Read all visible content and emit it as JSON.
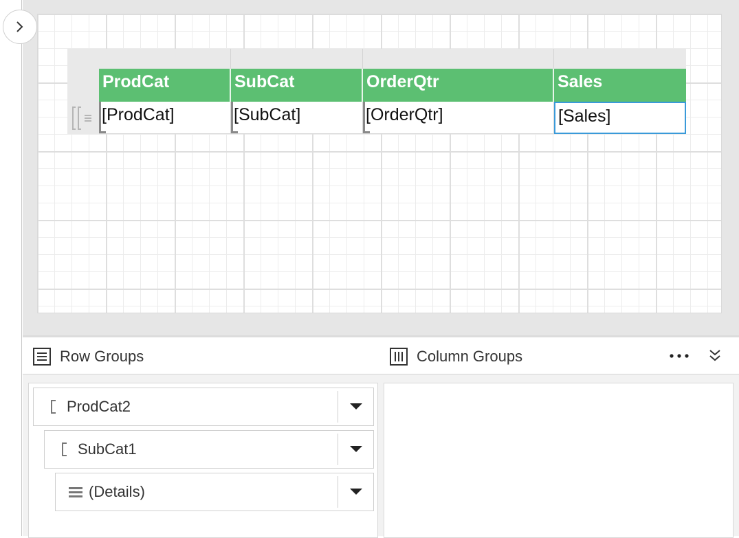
{
  "report": {
    "headers": [
      "ProdCat",
      "SubCat",
      "OrderQtr",
      "Sales"
    ],
    "fields": [
      "[ProdCat]",
      "[SubCat]",
      "[OrderQtr]",
      "[Sales]"
    ],
    "header_color": "#5cbf72",
    "selected_color": "#3a9ad9"
  },
  "groups_panel": {
    "row_groups_title": "Row Groups",
    "column_groups_title": "Column Groups",
    "row_groups": [
      {
        "label": "ProdCat2",
        "icon": "group-bracket-icon"
      },
      {
        "label": "SubCat1",
        "icon": "group-bracket-icon"
      },
      {
        "label": "(Details)",
        "icon": "details-lines-icon"
      }
    ],
    "column_groups": []
  },
  "icons": {
    "sidebar_toggle": "chevron-right-icon",
    "row_groups": "row-groups-icon",
    "column_groups": "column-groups-icon",
    "more": "more-options-icon",
    "collapse": "double-chevron-down-icon",
    "dropdown": "caret-down-icon"
  }
}
